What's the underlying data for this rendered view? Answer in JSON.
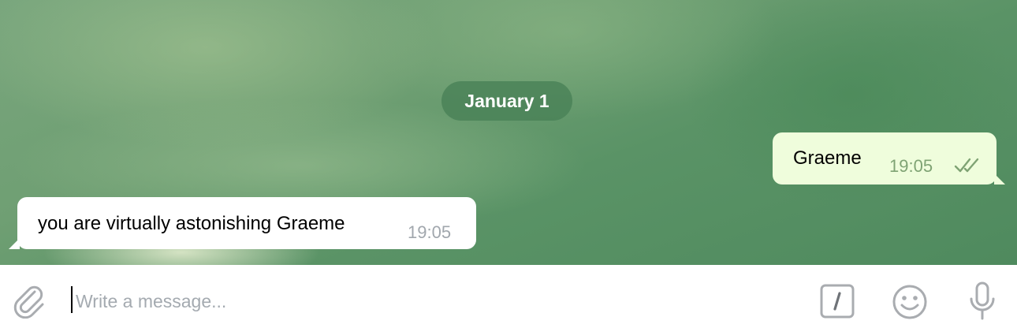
{
  "chat": {
    "date_separator": "January 1",
    "messages": [
      {
        "direction": "outgoing",
        "text": "Graeme",
        "time": "19:05",
        "status": "read"
      },
      {
        "direction": "incoming",
        "text": "you are virtually astonishing Graeme",
        "time": "19:05"
      }
    ]
  },
  "composer": {
    "placeholder": "Write a message...",
    "value": "",
    "icons": [
      "paperclip-icon",
      "bot-commands-icon",
      "emoji-icon",
      "microphone-icon"
    ]
  },
  "colors": {
    "background": "#6f9f73",
    "outgoing_bubble": "#effddc",
    "incoming_bubble": "#ffffff",
    "outgoing_time": "#7fa374",
    "incoming_time": "#a1a7ad",
    "date_pill": "#4a8056",
    "icon_gray": "#a9acb0"
  }
}
